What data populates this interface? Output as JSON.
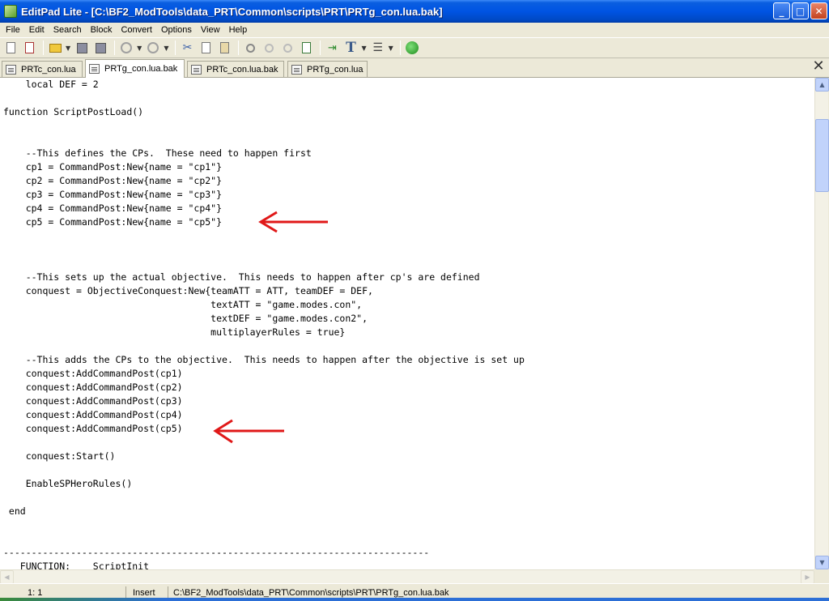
{
  "window": {
    "title": "EditPad Lite - [C:\\BF2_ModTools\\data_PRT\\Common\\scripts\\PRT\\PRTg_con.lua.bak]",
    "min_label": "_",
    "max_label": "□",
    "close_label": "✕"
  },
  "menu": [
    "File",
    "Edit",
    "Search",
    "Block",
    "Convert",
    "Options",
    "View",
    "Help"
  ],
  "tabs": [
    {
      "label": "PRTc_con.lua",
      "active": false
    },
    {
      "label": "PRTg_con.lua.bak",
      "active": true
    },
    {
      "label": "PRTc_con.lua.bak",
      "active": false
    },
    {
      "label": "PRTg_con.lua",
      "active": false
    }
  ],
  "tab_close_label": "✕",
  "toolbar_icons": [
    "new-file-icon",
    "close-file-icon",
    "open-folder-icon",
    "save-icon",
    "save-all-icon",
    "undo-icon",
    "redo-icon",
    "cut-icon",
    "copy-icon",
    "paste-icon",
    "find-icon",
    "find-next-icon",
    "find-prev-icon",
    "replace-icon",
    "indent-icon",
    "font-icon",
    "block-icon",
    "web-icon"
  ],
  "code_lines": [
    "    local DEF = 2",
    "",
    "function ScriptPostLoad()",
    "",
    "",
    "    --This defines the CPs.  These need to happen first",
    "    cp1 = CommandPost:New{name = \"cp1\"}",
    "    cp2 = CommandPost:New{name = \"cp2\"}",
    "    cp3 = CommandPost:New{name = \"cp3\"}",
    "    cp4 = CommandPost:New{name = \"cp4\"}",
    "    cp5 = CommandPost:New{name = \"cp5\"}",
    "",
    "",
    "",
    "    --This sets up the actual objective.  This needs to happen after cp's are defined",
    "    conquest = ObjectiveConquest:New{teamATT = ATT, teamDEF = DEF,",
    "                                     textATT = \"game.modes.con\",",
    "                                     textDEF = \"game.modes.con2\",",
    "                                     multiplayerRules = true}",
    "",
    "    --This adds the CPs to the objective.  This needs to happen after the objective is set up",
    "    conquest:AddCommandPost(cp1)",
    "    conquest:AddCommandPost(cp2)",
    "    conquest:AddCommandPost(cp3)",
    "    conquest:AddCommandPost(cp4)",
    "    conquest:AddCommandPost(cp5)",
    "",
    "    conquest:Start()",
    "",
    "    EnableSPHeroRules()",
    "",
    " end",
    "",
    "",
    "----------------------------------------------------------------------------",
    "   FUNCTION:    ScriptInit"
  ],
  "annotations": [
    {
      "name": "red-arrow-cp5-definition",
      "line": 10,
      "color": "#e01818"
    },
    {
      "name": "red-arrow-cp5-addcommandpost",
      "line": 25,
      "color": "#e01818"
    }
  ],
  "status": {
    "position": "1: 1",
    "mode": "Insert",
    "path": "C:\\BF2_ModTools\\data_PRT\\Common\\scripts\\PRT\\PRTg_con.lua.bak"
  }
}
